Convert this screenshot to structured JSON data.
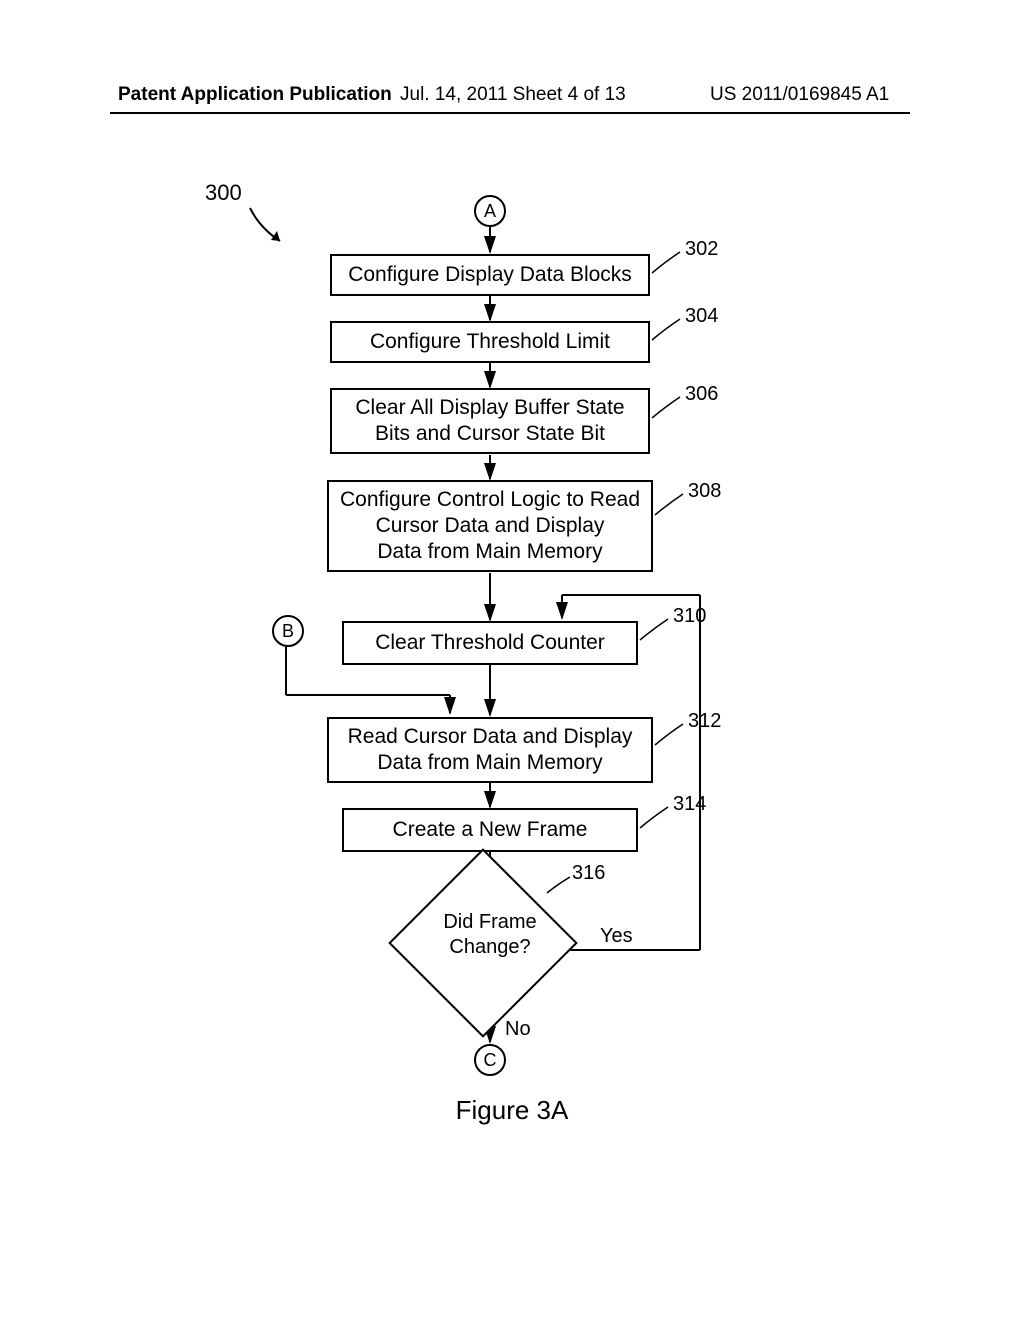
{
  "header": {
    "left": "Patent Application Publication",
    "mid": "Jul. 14, 2011  Sheet 4 of 13",
    "right": "US 2011/0169845 A1"
  },
  "figure_label": "Figure 3A",
  "ref300": "300",
  "connectors": {
    "a": "A",
    "b": "B",
    "c": "C"
  },
  "steps": {
    "s302": {
      "text": "Configure Display Data Blocks",
      "ref": "302"
    },
    "s304": {
      "text": "Configure Threshold Limit",
      "ref": "304"
    },
    "s306": {
      "text": "Clear All Display Buffer State\nBits and Cursor State Bit",
      "ref": "306"
    },
    "s308": {
      "text": "Configure Control Logic to Read\nCursor Data and Display\nData from Main Memory",
      "ref": "308"
    },
    "s310": {
      "text": "Clear Threshold Counter",
      "ref": "310"
    },
    "s312": {
      "text": "Read Cursor Data and Display\nData from Main Memory",
      "ref": "312"
    },
    "s314": {
      "text": "Create a New Frame",
      "ref": "314"
    },
    "s316": {
      "text": "Did\nFrame\nChange?",
      "ref": "316"
    }
  },
  "edges": {
    "yes": "Yes",
    "no": "No"
  }
}
